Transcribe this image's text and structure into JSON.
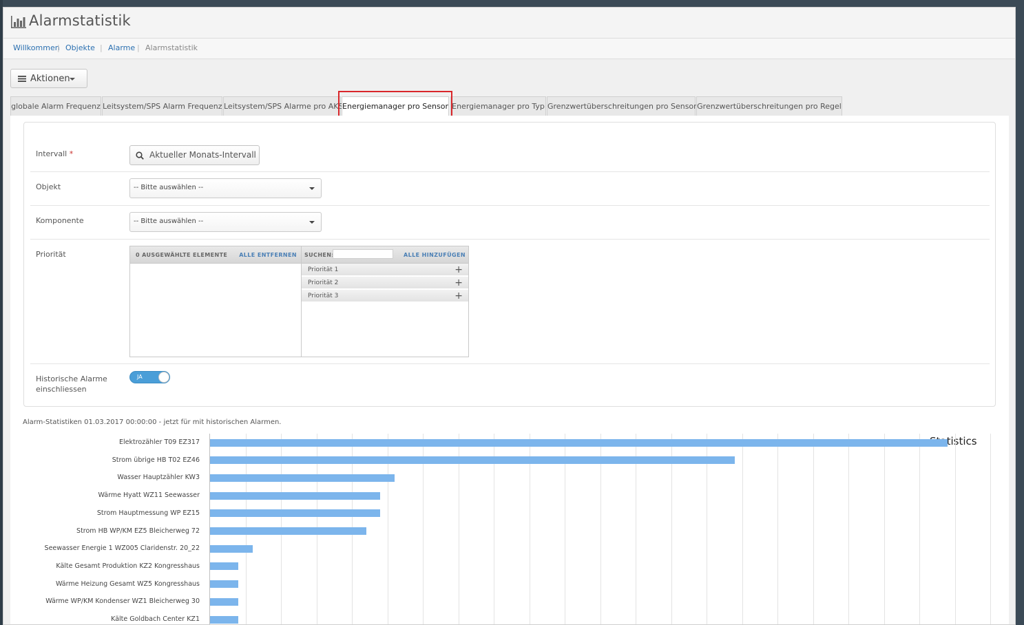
{
  "header": {
    "title": "Alarmstatistik",
    "title_icon": "bar-chart-icon"
  },
  "breadcrumb": [
    {
      "label": "Willkommen"
    },
    {
      "label": "Objekte"
    },
    {
      "label": "Alarme"
    },
    {
      "label": "Alarmstatistik"
    }
  ],
  "toolbar": {
    "actions_label": "Aktionen"
  },
  "tabs": [
    {
      "label": "globale Alarm Frequenz"
    },
    {
      "label": "Leitsystem/SPS Alarm Frequenz"
    },
    {
      "label": "Leitsystem/SPS Alarme pro AKS"
    },
    {
      "label": "Energiemanager pro Sensor",
      "active": true
    },
    {
      "label": "Energiemanager pro Typ"
    },
    {
      "label": "Grenzwertüberschreitungen pro Sensor"
    },
    {
      "label": "Grenzwertüberschreitungen pro Regel"
    }
  ],
  "form": {
    "interval": {
      "label": "Intervall",
      "required": "*",
      "button": "Aktueller Monats-Intervall"
    },
    "object": {
      "label": "Objekt",
      "value": "-- Bitte auswählen --"
    },
    "component": {
      "label": "Komponente",
      "value": "-- Bitte auswählen --"
    },
    "priority": {
      "label": "Priorität",
      "selected_header": "0 AUSGEWÄHLTE ELEMENTE",
      "remove_all": "ALLE ENTFERNEN",
      "search_label": "SUCHEN:",
      "add_all": "ALLE HINZUFÜGEN",
      "items": [
        "Priorität 1",
        "Priorität 2",
        "Priorität 3"
      ]
    },
    "historic": {
      "label_line1": "Historische Alarme",
      "label_line2": "einschliessen",
      "toggle": "JA"
    }
  },
  "stats_caption": "Alarm-Statistiken 01.03.2017 00:00:00 - jetzt für mit historischen Alarmen.",
  "colors": {
    "bar": "#7cb5ec",
    "link": "#2a6fb0",
    "highlight": "#d9262a",
    "toggle": "#4a9ed8"
  },
  "chart_data": {
    "type": "bar",
    "orientation": "horizontal",
    "title": "Statistics",
    "categories": [
      "Elektrozähler T09 EZ317",
      "Strom übrige HB T02 EZ46",
      "Wasser Hauptzähler KW3",
      "Wärme Hyatt WZ11 Seewasser",
      "Strom Hauptmessung WP EZ15",
      "Strom HB WP/KM EZ5 Bleicherweg 72",
      "Seewasser Energie 1 WZ005 Claridenstr. 20_22",
      "Kälte Gesamt Produktion KZ2 Kongresshaus",
      "Wärme Heizung Gesamt WZ5 Kongresshaus",
      "Wärme WP/KM Kondenser WZ1 Bleicherweg 30",
      "Kälte Goldbach Center KZ1"
    ],
    "values": [
      52,
      37,
      13,
      12,
      12,
      11,
      3,
      2,
      2,
      2,
      2
    ],
    "xlim": [
      0,
      55
    ],
    "grid": true,
    "legend": "none"
  }
}
